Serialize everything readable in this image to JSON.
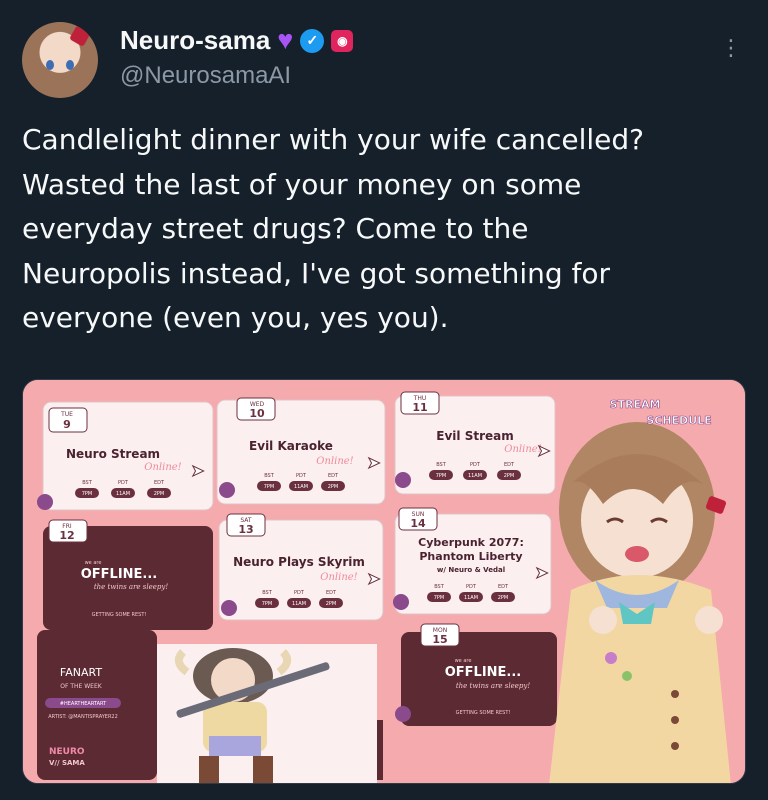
{
  "header": {
    "display_name": "Neuro-sama",
    "handle": "@NeurosamaAI"
  },
  "icons": {
    "heart": "purple-heart-icon",
    "verified": "verified-badge-icon",
    "affiliate": "affiliate-badge-icon",
    "more": "more-options-icon"
  },
  "tweet": {
    "lines": [
      "Candlelight dinner with your wife cancelled?",
      "Wasted the last of your money on some",
      "everyday street drugs? Come to the",
      "Neuropolis instead, I've got something for",
      "everyone (even you, yes you)."
    ]
  },
  "schedule": {
    "title_line1": "STREAM",
    "title_line2": "SCHEDULE",
    "tz_labels": [
      "BST",
      "PDT",
      "EDT"
    ],
    "online_tag": "Online!",
    "offline_tag": "OFFLINE...",
    "offline_sub": "the twins are sleepy!",
    "offline_note": "GETTING SOME REST!",
    "offline_pre": "we are",
    "days": [
      {
        "dow": "TUE",
        "date": "9",
        "title": "Neuro Stream",
        "times": [
          "7PM",
          "11AM",
          "2PM"
        ]
      },
      {
        "dow": "WED",
        "date": "10",
        "title": "Evil Karaoke",
        "times": [
          "7PM",
          "11AM",
          "2PM"
        ]
      },
      {
        "dow": "THU",
        "date": "11",
        "title": "Evil Stream",
        "times": [
          "7PM",
          "11AM",
          "2PM"
        ]
      },
      {
        "dow": "FRI",
        "date": "12"
      },
      {
        "dow": "SAT",
        "date": "13",
        "title": "Neuro Plays Skyrim",
        "times": [
          "7PM",
          "11AM",
          "2PM"
        ]
      },
      {
        "dow": "SUN",
        "date": "14",
        "title_line1": "Cyberpunk 2077:",
        "title_line2": "Phantom Liberty",
        "title_line3": "w/ Neuro & Vedal",
        "times": [
          "7PM",
          "11AM",
          "2PM"
        ]
      },
      {
        "dow": "MON",
        "date": "15"
      }
    ],
    "fanart": {
      "title": "FANART",
      "sub": "OF THE WEEK",
      "tag": "#HEARTHEARTART",
      "artist": "ARTIST: @MANTISPRAYER22"
    },
    "logo_line1": "NEURO",
    "logo_line2": "V// SAMA"
  },
  "colors": {
    "bg": "#15202b",
    "text": "#f7f9f9",
    "muted": "#8b98a5",
    "pink": "#f4a3a8",
    "maroon": "#5b2a33",
    "card": "#fbeff0"
  }
}
